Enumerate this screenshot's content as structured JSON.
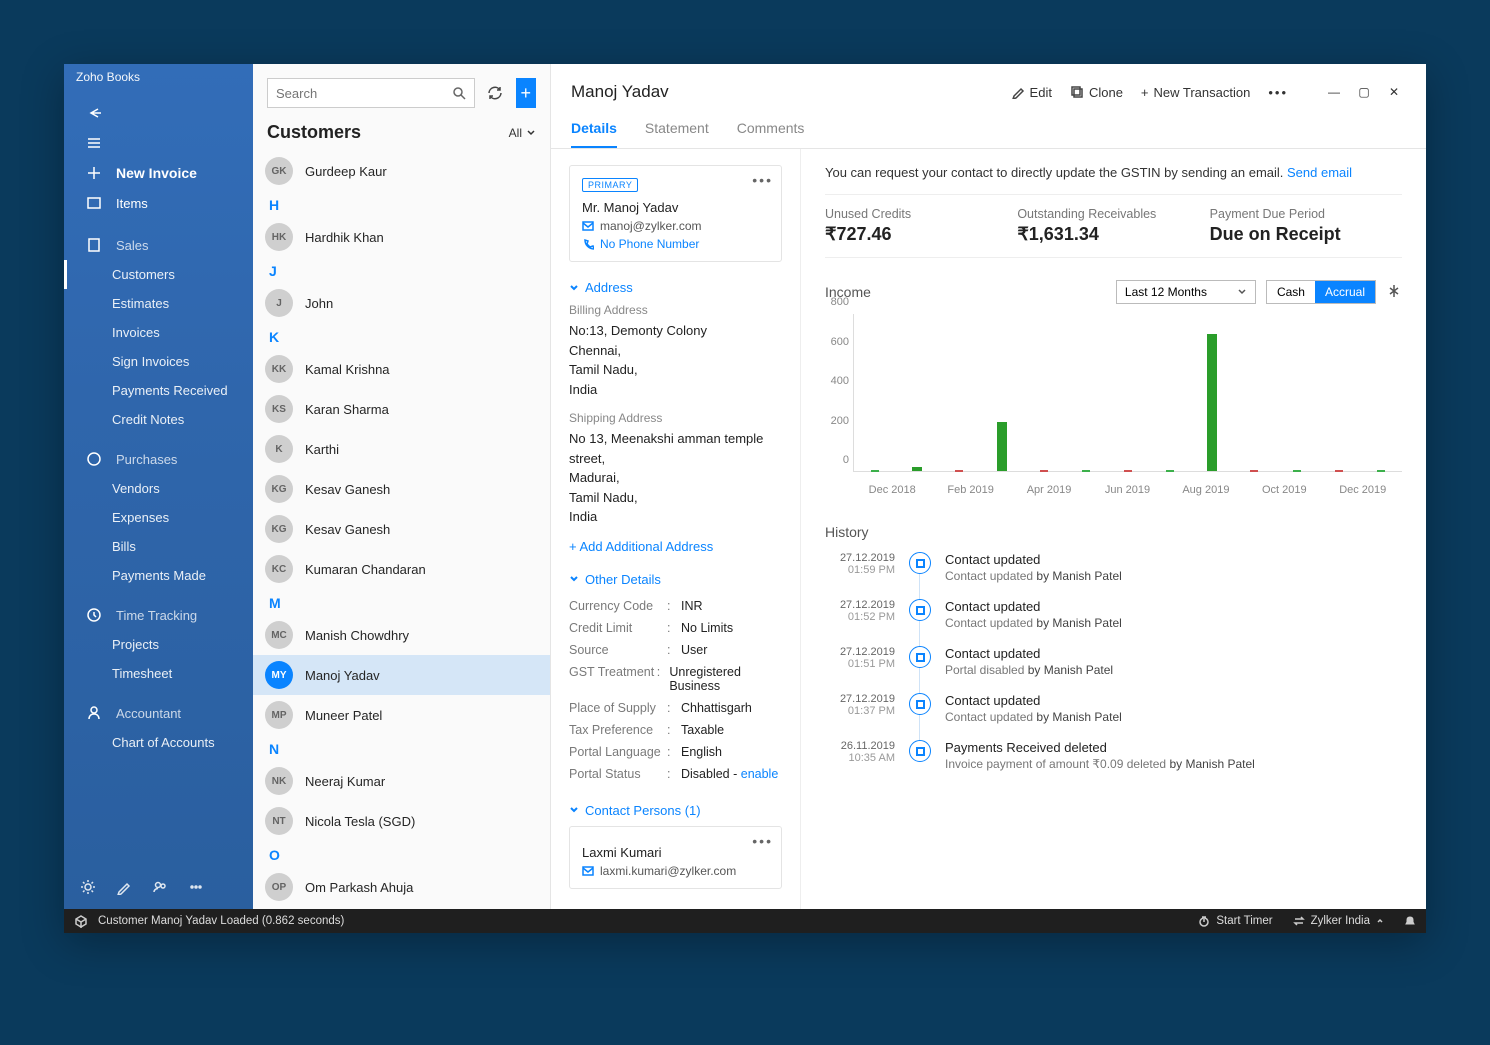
{
  "app_title": "Zoho Books",
  "window": {
    "minimize": "—",
    "maximize": "▢",
    "close": "✕"
  },
  "sidebar": {
    "new_invoice": "New Invoice",
    "items": "Items",
    "sales": "Sales",
    "sales_items": [
      "Customers",
      "Estimates",
      "Invoices",
      "Sign Invoices",
      "Payments Received",
      "Credit Notes"
    ],
    "purchases": "Purchases",
    "purchases_items": [
      "Vendors",
      "Expenses",
      "Bills",
      "Payments Made"
    ],
    "time_tracking": "Time Tracking",
    "time_items": [
      "Projects",
      "Timesheet"
    ],
    "accountant": "Accountant",
    "acc_items": [
      "Chart of Accounts"
    ]
  },
  "search_placeholder": "Search",
  "customers_heading": "Customers",
  "filter_label": "All",
  "customers": [
    {
      "alpha": "",
      "initials": "GK",
      "name": "Gurdeep Kaur"
    },
    {
      "alpha": "H",
      "initials": "HK",
      "name": "Hardhik Khan"
    },
    {
      "alpha": "J",
      "initials": "J",
      "name": "John"
    },
    {
      "alpha": "K",
      "initials": "KK",
      "name": "Kamal Krishna"
    },
    {
      "alpha": "",
      "initials": "KS",
      "name": "Karan Sharma"
    },
    {
      "alpha": "",
      "initials": "K",
      "name": "Karthi"
    },
    {
      "alpha": "",
      "initials": "KG",
      "name": "Kesav Ganesh"
    },
    {
      "alpha": "",
      "initials": "KG",
      "name": "Kesav Ganesh"
    },
    {
      "alpha": "",
      "initials": "KC",
      "name": "Kumaran Chandaran"
    },
    {
      "alpha": "M",
      "initials": "MC",
      "name": "Manish Chowdhry"
    },
    {
      "alpha": "",
      "initials": "MY",
      "name": "Manoj Yadav",
      "selected": true
    },
    {
      "alpha": "",
      "initials": "MP",
      "name": "Muneer Patel"
    },
    {
      "alpha": "N",
      "initials": "NK",
      "name": "Neeraj Kumar"
    },
    {
      "alpha": "",
      "initials": "NT",
      "name": "Nicola Tesla (SGD)"
    },
    {
      "alpha": "O",
      "initials": "OP",
      "name": "Om Parkash Ahuja"
    }
  ],
  "detail": {
    "title": "Manoj Yadav",
    "actions": {
      "edit": "Edit",
      "clone": "Clone",
      "new_txn": "New Transaction"
    },
    "tabs": [
      "Details",
      "Statement",
      "Comments"
    ],
    "primary_badge": "PRIMARY",
    "primary_name": "Mr. Manoj Yadav",
    "primary_email": "manoj@zylker.com",
    "primary_phone": "No Phone Number",
    "address_heading": "Address",
    "billing_label": "Billing Address",
    "billing_lines": [
      "No:13, Demonty Colony",
      "Chennai,",
      "Tamil Nadu,",
      "India"
    ],
    "shipping_label": "Shipping Address",
    "shipping_lines": [
      "No 13, Meenakshi amman temple street,",
      "Madurai,",
      "Tamil Nadu,",
      "India"
    ],
    "add_address": "+ Add Additional Address",
    "other_details_heading": "Other Details",
    "other": [
      {
        "k": "Currency Code",
        "v": "INR"
      },
      {
        "k": "Credit Limit",
        "v": "No Limits"
      },
      {
        "k": "Source",
        "v": "User"
      },
      {
        "k": "GST Treatment",
        "v": "Unregistered Business"
      },
      {
        "k": "Place of Supply",
        "v": "Chhattisgarh"
      },
      {
        "k": "Tax Preference",
        "v": "Taxable"
      },
      {
        "k": "Portal Language",
        "v": "English"
      },
      {
        "k": "Portal Status",
        "v": "Disabled",
        "extra": "enable"
      }
    ],
    "contact_persons_heading": "Contact Persons (1)",
    "contact_person": {
      "name": "Laxmi Kumari",
      "email": "laxmi.kumari@zylker.com"
    }
  },
  "right": {
    "gstin_msg": "You can request your contact to directly update the GSTIN by sending an email. ",
    "gstin_link": "Send email",
    "stats": [
      {
        "label": "Unused Credits",
        "value": "₹727.46"
      },
      {
        "label": "Outstanding Receivables",
        "value": "₹1,631.34"
      },
      {
        "label": "Payment Due Period",
        "value": "Due on Receipt"
      }
    ],
    "income_label": "Income",
    "range": "Last 12 Months",
    "toggle_cash": "Cash",
    "toggle_accrual": "Accrual",
    "history_heading": "History",
    "history": [
      {
        "date": "27.12.2019",
        "time": "01:59 PM",
        "title": "Contact updated",
        "desc": "Contact updated",
        "by": "by Manish Patel"
      },
      {
        "date": "27.12.2019",
        "time": "01:52 PM",
        "title": "Contact updated",
        "desc": "Contact updated",
        "by": "by Manish Patel"
      },
      {
        "date": "27.12.2019",
        "time": "01:51 PM",
        "title": "Contact updated",
        "desc": "Portal disabled",
        "by": "by Manish Patel"
      },
      {
        "date": "27.12.2019",
        "time": "01:37 PM",
        "title": "Contact updated",
        "desc": "Contact updated",
        "by": "by Manish Patel"
      },
      {
        "date": "26.11.2019",
        "time": "10:35 AM",
        "title": "Payments Received deleted",
        "desc": "Invoice payment of amount ₹0.09 deleted",
        "by": "by Manish Patel"
      }
    ]
  },
  "chart_data": {
    "type": "bar",
    "title": "Income",
    "ylabel": "",
    "ylim": [
      0,
      800
    ],
    "y_ticks": [
      0,
      200,
      400,
      600,
      800
    ],
    "categories": [
      "Dec 2018",
      "Jan 2019",
      "Feb 2019",
      "Mar 2019",
      "Apr 2019",
      "May 2019",
      "Jun 2019",
      "Jul 2019",
      "Aug 2019",
      "Sep 2019",
      "Oct 2019",
      "Nov 2019",
      "Dec 2019"
    ],
    "x_labels_shown": [
      "Dec 2018",
      "Feb 2019",
      "Apr 2019",
      "Jun 2019",
      "Aug 2019",
      "Oct 2019",
      "Dec 2019"
    ],
    "values": [
      0,
      20,
      0,
      250,
      0,
      0,
      0,
      0,
      700,
      0,
      0,
      0,
      0
    ],
    "baseline_ticks": [
      "green",
      "none",
      "red",
      "none",
      "red",
      "green",
      "red",
      "green",
      "none",
      "red",
      "green",
      "red",
      "green"
    ]
  },
  "statusbar": {
    "msg": "Customer Manoj Yadav Loaded (0.862 seconds)",
    "start_timer": "Start Timer",
    "org": "Zylker India"
  }
}
